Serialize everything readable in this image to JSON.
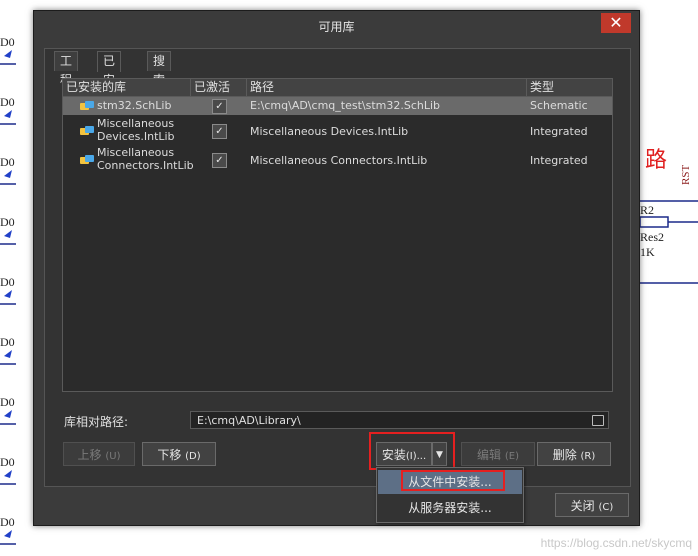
{
  "dialog": {
    "title": "可用库",
    "close_glyph": "✕",
    "tabs": [
      "工程",
      "已安装",
      "搜索路径"
    ]
  },
  "table": {
    "columns": [
      "已安装的库",
      "已激活",
      "路径",
      "类型"
    ],
    "rows": [
      {
        "name_l1": "stm32.SchLib",
        "name_l2": "",
        "active": true,
        "path": "E:\\cmq\\AD\\cmq_test\\stm32.SchLib",
        "type": "Schematic"
      },
      {
        "name_l1": "Miscellaneous",
        "name_l2": "Devices.IntLib",
        "active": true,
        "path": "Miscellaneous Devices.IntLib",
        "type": "Integrated"
      },
      {
        "name_l1": "Miscellaneous",
        "name_l2": "Connectors.IntLib",
        "active": true,
        "path": "Miscellaneous Connectors.IntLib",
        "type": "Integrated"
      }
    ]
  },
  "relative_path": {
    "label": "库相对路径:",
    "value": "E:\\cmq\\AD\\Library\\"
  },
  "buttons": {
    "move_up": {
      "label": "上移",
      "key": "(U)"
    },
    "move_down": {
      "label": "下移",
      "key": "(D)"
    },
    "install": {
      "label": "安装",
      "key": "(I)..."
    },
    "edit": {
      "label": "编辑",
      "key": "(E)"
    },
    "delete": {
      "label": "删除",
      "key": "(R)"
    },
    "close": {
      "label": "关闭",
      "key": "(C)"
    }
  },
  "install_menu": {
    "items": [
      "从文件中安装...",
      "从服务器安装..."
    ]
  },
  "background": {
    "pin_labels": [
      "D0",
      "D0",
      "D0",
      "D0",
      "D0",
      "D0",
      "D0",
      "D0",
      "D0"
    ],
    "heading_char": "路",
    "rst": "RST",
    "ref": "R2",
    "part": "Res2",
    "value": "1K",
    "watermark": "https://blog.csdn.net/skycmq"
  },
  "colors": {
    "dialog_bg": "#3b3b3b",
    "highlight_red": "#e52020",
    "menu_hover": "#5d6f86"
  }
}
